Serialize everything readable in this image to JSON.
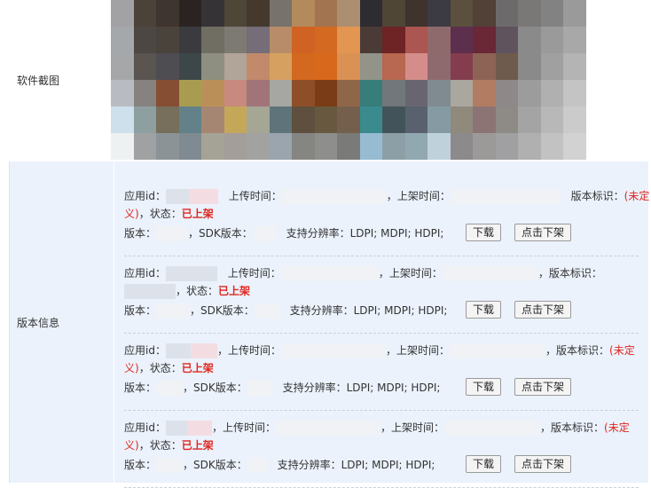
{
  "screenshot_row": {
    "label": "软件截图"
  },
  "mosaic_colors": [
    "#a2a1a4",
    "#4b4239",
    "#3f3530",
    "#2b2322",
    "#363337",
    "#4e4637",
    "#45392e",
    "#78726c",
    "#b38a5b",
    "#a2744f",
    "#ac8e71",
    "#2d2c30",
    "#504636",
    "#3e332d",
    "#3c3b43",
    "#5a503d",
    "#514137",
    "#6d6a6b",
    "#7a7877",
    "#828282",
    "#9a9a9a",
    "#a5a8ab",
    "#4c4743",
    "#49433c",
    "#3b3b3f",
    "#706d63",
    "#7d7a73",
    "#756d78",
    "#b88c68",
    "#d06323",
    "#d46a22",
    "#e39552",
    "#4b3b37",
    "#6e2425",
    "#ab5651",
    "#8f6a6d",
    "#5c2f4c",
    "#6a2736",
    "#5f535d",
    "#8a8a8a",
    "#9a9a9a",
    "#a8a8a8",
    "#a6a7a8",
    "#5a5551",
    "#4e4d52",
    "#3d4749",
    "#8e8f80",
    "#b0a598",
    "#c28a6a",
    "#d6a061",
    "#d3691f",
    "#d8681c",
    "#da9154",
    "#929489",
    "#b86750",
    "#d48d8b",
    "#8e6a6f",
    "#833d4e",
    "#8d6356",
    "#6e5b4e",
    "#8a8a8a",
    "#a0a0a0",
    "#b4b4b4",
    "#b8bcc2",
    "#868280",
    "#864e33",
    "#a89c50",
    "#bb9058",
    "#c88a7e",
    "#a07478",
    "#a6a7a2",
    "#8e4e28",
    "#7a3c17",
    "#906648",
    "#377d79",
    "#71777a",
    "#686571",
    "#7f8a91",
    "#aaa79f",
    "#b27c62",
    "#8e8888",
    "#9c9c9c",
    "#b0b0b0",
    "#c4c4c4",
    "#cde0ec",
    "#8da09f",
    "#776e5c",
    "#628188",
    "#a58673",
    "#c5a75a",
    "#a6a694",
    "#5f737b",
    "#5f4f3f",
    "#67583f",
    "#745f4c",
    "#3a8a8e",
    "#425459",
    "#58616d",
    "#869aa3",
    "#908a7d",
    "#8c7474",
    "#8e8a85",
    "#a4a4a4",
    "#b8b8b8",
    "#cbcbcb",
    "#edf1f2",
    "#9fa1a3",
    "#8c9396",
    "#808a93",
    "#a5a396",
    "#a49e9a",
    "#a2a3a1",
    "#9aa5ae",
    "#858582",
    "#8e8e8c",
    "#7a7a78",
    "#97bcd1",
    "#8d9fa6",
    "#91a8b1",
    "#bfd2dc",
    "#8d8a8b",
    "#9b9a99",
    "#a0a0a2",
    "#b0b0b0",
    "#c2c2c2",
    "#d2d2d2"
  ],
  "info_row": {
    "label": "版本信息"
  },
  "labels": {
    "app_id": "应用id：",
    "upload_time": "上传时间：",
    "shelf_time": "上架时间：",
    "version_tag": "版本标识：",
    "comma": "，",
    "status": "状态：",
    "version": "版本：",
    "sdk_version": "SDK版本：",
    "resolution": "支持分辨率："
  },
  "versions": [
    {
      "tag": "(未定义)",
      "tag_start": "(未定",
      "tag_end": "义)",
      "status": "已上架",
      "resolutions": "LDPI; MDPI; HDPI;",
      "download_label": "下载",
      "unshelf_label": "点击下架"
    },
    {
      "tag": "",
      "tag_start": "",
      "tag_end": "",
      "status": "已上架",
      "resolutions": "LDPI; MDPI; HDPI;",
      "download_label": "下载",
      "unshelf_label": "点击下架"
    },
    {
      "tag": "(未定义)",
      "tag_start": "(未定",
      "tag_end": "义)",
      "status": "已上架",
      "resolutions": "LDPI; MDPI; HDPI;",
      "download_label": "下载",
      "unshelf_label": "点击下架"
    },
    {
      "tag": "(未定义)",
      "tag_start": "(未定",
      "tag_end": "义)",
      "status": "已上架",
      "resolutions": "LDPI; MDPI; HDPI;",
      "download_label": "下载",
      "unshelf_label": "点击下架"
    }
  ]
}
